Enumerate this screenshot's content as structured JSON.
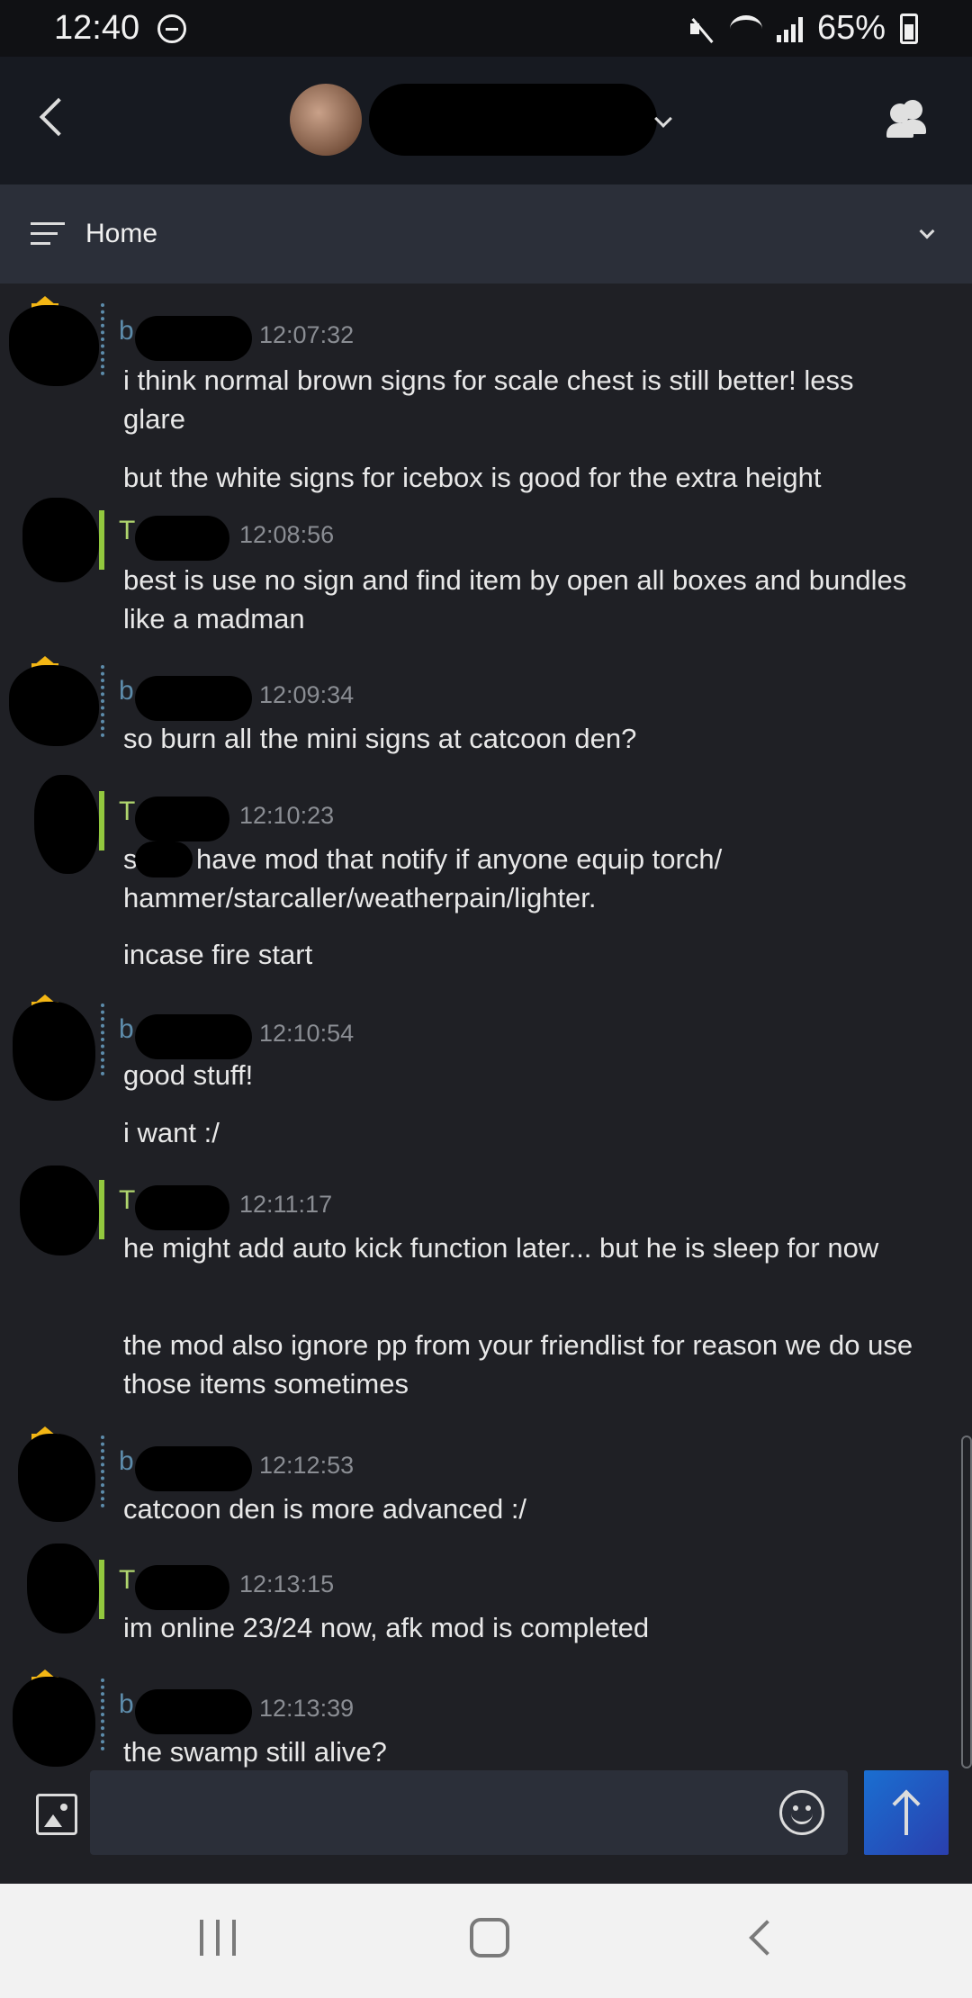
{
  "status_bar": {
    "time": "12:40",
    "battery": "65%"
  },
  "header": {
    "back_icon": "chevron-left-icon",
    "friends_icon": "friends-icon"
  },
  "channel_bar": {
    "label": "Home"
  },
  "messages": [
    {
      "initial": "b",
      "time": "12:07:32",
      "lines": [
        "i think normal brown signs for scale chest is still better! less glare",
        "but the white signs for icebox is good for the extra height"
      ]
    },
    {
      "initial": "T",
      "time": "12:08:56",
      "lines": [
        "best is use no sign and find item by open all boxes and bundles like a madman"
      ]
    },
    {
      "initial": "b",
      "time": "12:09:34",
      "lines": [
        "so burn all the mini signs at catcoon den?"
      ]
    },
    {
      "initial": "T",
      "time": "12:10:23",
      "lines": [
        "s",
        "have mod that notify if anyone equip torch/",
        "hammer/starcaller/weatherpain/lighter.",
        "incase fire start"
      ]
    },
    {
      "initial": "b",
      "time": "12:10:54",
      "lines": [
        "good stuff!",
        "i want :/"
      ]
    },
    {
      "initial": "T",
      "time": "12:11:17",
      "lines": [
        "he might add auto kick function later... but he is sleep for now",
        "the mod also ignore pp from your friendlist for reason we do use those items sometimes"
      ]
    },
    {
      "initial": "b",
      "time": "12:12:53",
      "lines": [
        "catcoon den is more advanced :/"
      ]
    },
    {
      "initial": "T",
      "time": "12:13:15",
      "lines": [
        "im online 23/24 now, afk mod is completed"
      ]
    },
    {
      "initial": "b",
      "time": "12:13:39",
      "lines": [
        "the swamp still alive?"
      ]
    }
  ],
  "input": {
    "placeholder": ""
  },
  "colors": {
    "background": "#1f2025",
    "header": "#171a21",
    "channel_bar": "#2b2f39",
    "owner_status": "#5d8cab",
    "online_status": "#92c83e",
    "crown": "#f3b614",
    "send_button": "#1a6fd1"
  }
}
